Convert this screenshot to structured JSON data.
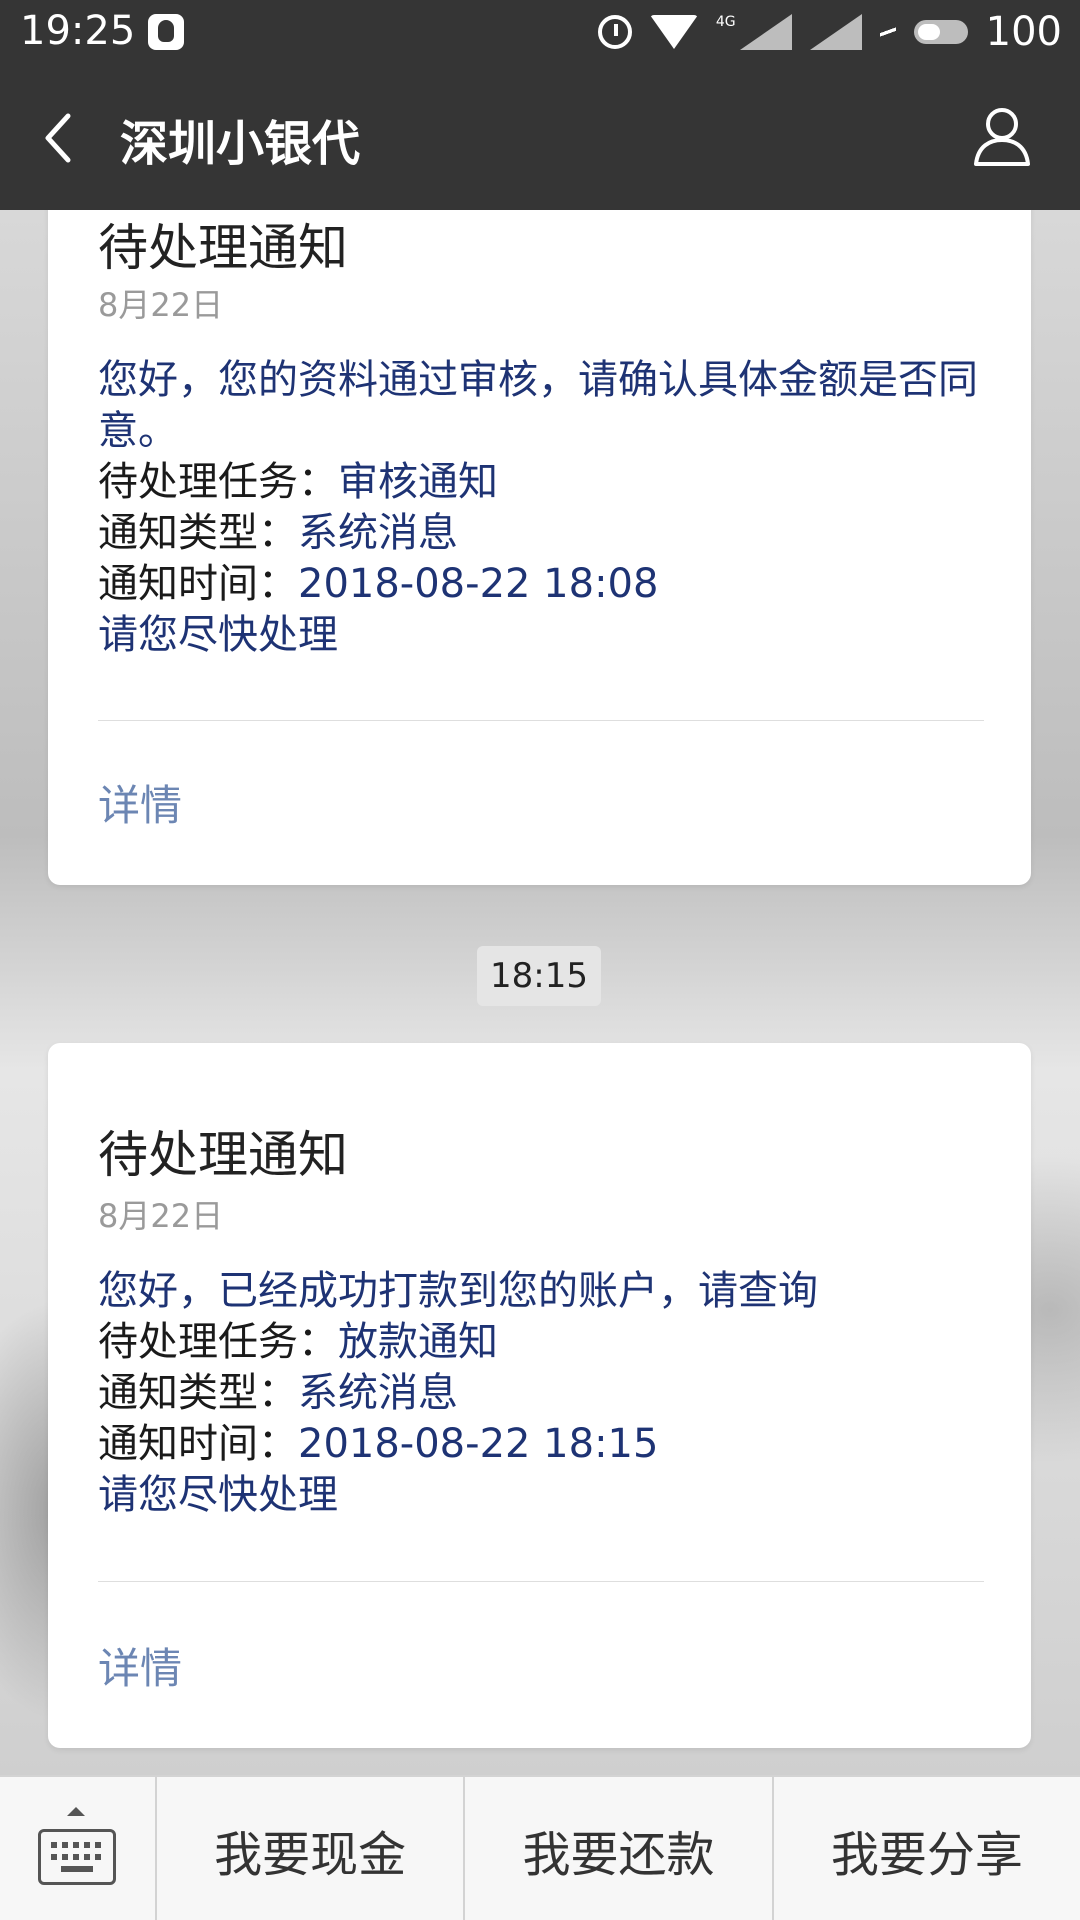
{
  "status_bar": {
    "time": "19:25",
    "network_label": "4G",
    "battery": "100",
    "icons": [
      "qq-icon",
      "alarm-icon",
      "wifi-icon",
      "signal-icon",
      "signal-icon",
      "charging-icon",
      "battery-icon"
    ]
  },
  "nav": {
    "title": "深圳小银代",
    "back_icon": "chevron-left-icon",
    "profile_icon": "person-icon"
  },
  "messages": [
    {
      "title": "待处理通知",
      "date": "8月22日",
      "intro": "您好，您的资料通过审核，请确认具体金额是否同意。",
      "task_label": "待处理任务：",
      "task_value": "审核通知",
      "type_label": "通知类型：",
      "type_value": "系统消息",
      "time_label": "通知时间：",
      "time_value": "2018-08-22 18:08",
      "closing": "请您尽快处理",
      "detail_label": "详情"
    },
    {
      "title": "待处理通知",
      "date": "8月22日",
      "intro": "您好，已经成功打款到您的账户，请查询",
      "task_label": "待处理任务：",
      "task_value": "放款通知",
      "type_label": "通知类型：",
      "type_value": "系统消息",
      "time_label": "通知时间：",
      "time_value": "2018-08-22 18:15",
      "closing": "请您尽快处理",
      "detail_label": "详情"
    }
  ],
  "time_divider": "18:15",
  "bottom_menu": {
    "keyboard_icon": "keyboard-icon",
    "items": [
      "我要现金",
      "我要还款",
      "我要分享"
    ]
  },
  "colors": {
    "header_bg": "#353535",
    "link_blue": "#1e3374",
    "detail_blue": "#6c86b3"
  }
}
